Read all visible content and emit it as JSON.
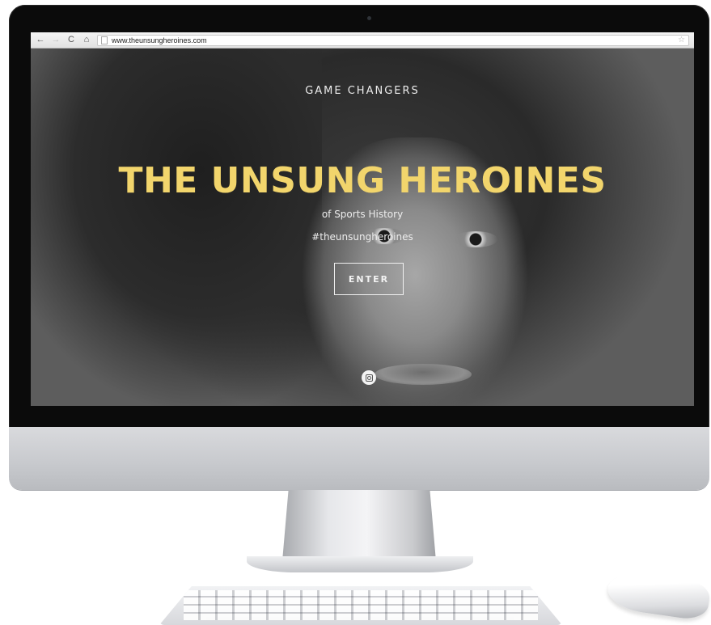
{
  "browser": {
    "url": "www.theunsungheroines.com",
    "back_icon": "←",
    "forward_icon": "→",
    "reload_icon": "C",
    "home_icon": "⌂",
    "star_icon": "☆"
  },
  "site": {
    "nav_title": "GAME CHANGERS",
    "headline": "THE UNSUNG HEROINES",
    "subhead": "of Sports History",
    "hashtag": "#theunsungheroines",
    "enter_label": "ENTER",
    "accent_color": "#f2d56c"
  },
  "icons": {
    "social": "instagram-icon"
  }
}
